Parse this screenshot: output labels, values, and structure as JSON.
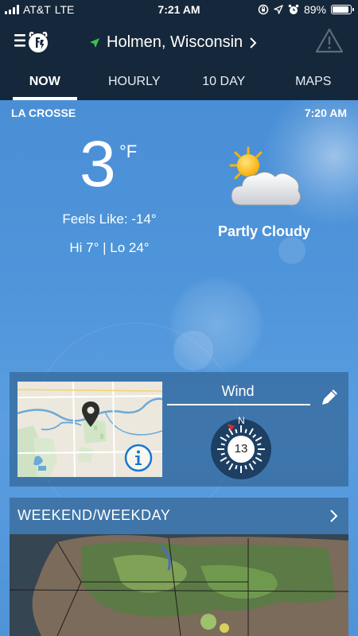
{
  "status_bar": {
    "carrier": "AT&T",
    "network": "LTE",
    "time": "7:21 AM",
    "battery": "89%",
    "battery_level": 0.89
  },
  "header": {
    "location": "Holmen, Wisconsin",
    "location_icon": "location-arrow-icon",
    "menu_icon": "menu-logo-icon",
    "alert_icon": "alert-triangle-icon"
  },
  "tabs": [
    {
      "label": "NOW",
      "active": true
    },
    {
      "label": "HOURLY",
      "active": false
    },
    {
      "label": "10 DAY",
      "active": false
    },
    {
      "label": "MAPS",
      "active": false
    }
  ],
  "current": {
    "station": "LA CROSSE",
    "obs_time": "7:20 AM",
    "temperature": "3",
    "unit": "°F",
    "feels_like": "Feels Like: -14°",
    "hi_lo": "Hi 7° | Lo 24°",
    "condition": "Partly Cloudy",
    "condition_icon": "partly-cloudy-icon"
  },
  "wind_card": {
    "title": "Wind",
    "speed": "13",
    "direction_label": "N",
    "edit_icon": "pencil-icon",
    "info_icon": "info-icon",
    "map_pin_icon": "map-pin-icon"
  },
  "weekend_card": {
    "title": "WEEKEND/WEEKDAY",
    "chevron_icon": "chevron-right-icon"
  },
  "colors": {
    "header_bg": "#15273a",
    "sky_top": "#4a8fd6",
    "accent_blue": "#1976d2",
    "wind_arrow": "#d32f2f"
  }
}
